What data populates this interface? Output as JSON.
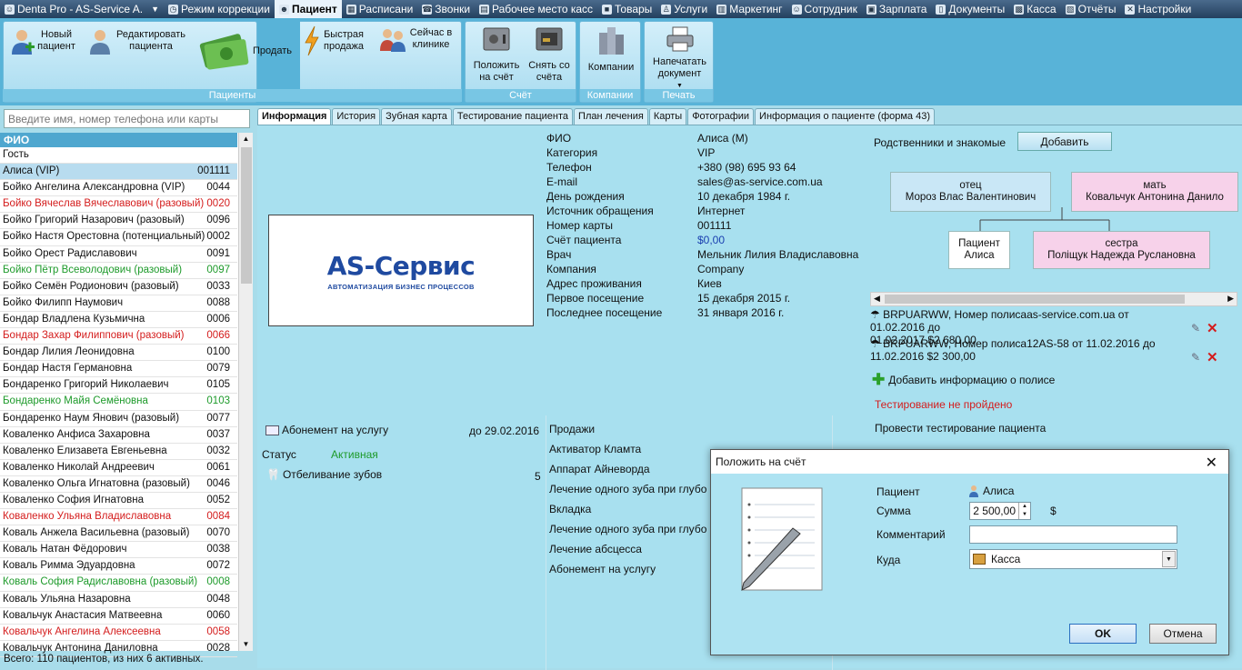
{
  "menubar": {
    "app_title": "Denta Pro - AS-Service A.",
    "items": [
      {
        "label": "Режим коррекции",
        "icon": "clock-icon"
      },
      {
        "label": "Пациент",
        "icon": "person-icon"
      },
      {
        "label": "Расписани",
        "icon": "calendar-icon"
      },
      {
        "label": "Звонки",
        "icon": "phone-icon"
      },
      {
        "label": "Рабочее место касс",
        "icon": "cashier-icon"
      },
      {
        "label": "Товары",
        "icon": "box-icon"
      },
      {
        "label": "Услуги",
        "icon": "tooth-icon"
      },
      {
        "label": "Маркетинг",
        "icon": "chart-icon"
      },
      {
        "label": "Сотрудник",
        "icon": "staff-icon"
      },
      {
        "label": "Зарплата",
        "icon": "money-icon"
      },
      {
        "label": "Документы",
        "icon": "document-icon"
      },
      {
        "label": "Касса",
        "icon": "register-icon"
      },
      {
        "label": "Отчёты",
        "icon": "report-icon"
      },
      {
        "label": "Настройки",
        "icon": "tools-icon"
      }
    ]
  },
  "ribbon": {
    "patients_group": "Пациенты",
    "new_patient": "Новый пациент",
    "edit_patient": "Редактировать пациента",
    "sell": "Продать",
    "quick_sale": "Быстрая продажа",
    "in_clinic": "Сейчас в клинике",
    "account_group": "Счёт",
    "deposit": "Положить на счёт",
    "withdraw": "Снять со счёта",
    "companies_group": "Компании",
    "companies": "Компании",
    "print_group": "Печать",
    "print_doc": "Напечатать документ"
  },
  "search": {
    "placeholder": "Введите имя, номер телефона или карты"
  },
  "patient_list": {
    "header": "ФИО",
    "footer": "Всего: 110 пациентов, из них 6 активных.",
    "rows": [
      {
        "name": "Гость",
        "id": "",
        "style": "normal"
      },
      {
        "name": "Алиса (VIP)",
        "id": "001111",
        "style": "selected"
      },
      {
        "name": "Бойко Ангелина Александровна (VIP)",
        "id": "0044",
        "style": "normal"
      },
      {
        "name": "Бойко Вячеслав Вячеславович (разовый)",
        "id": "0020",
        "style": "red"
      },
      {
        "name": "Бойко Григорий Назарович (разовый)",
        "id": "0096",
        "style": "normal"
      },
      {
        "name": "Бойко Настя Орестовна (потенциальный)",
        "id": "0002",
        "style": "normal"
      },
      {
        "name": "Бойко Орест Радиславович",
        "id": "0091",
        "style": "normal"
      },
      {
        "name": "Бойко Пётр Всеволодович (разовый)",
        "id": "0097",
        "style": "green"
      },
      {
        "name": "Бойко Семён Родионович (разовый)",
        "id": "0033",
        "style": "normal"
      },
      {
        "name": "Бойко Филипп Наумович",
        "id": "0088",
        "style": "normal"
      },
      {
        "name": "Бондар Владлена Кузьмична",
        "id": "0006",
        "style": "normal"
      },
      {
        "name": "Бондар Захар Филиппович (разовый)",
        "id": "0066",
        "style": "red"
      },
      {
        "name": "Бондар Лилия Леонидовна",
        "id": "0100",
        "style": "normal"
      },
      {
        "name": "Бондар Настя Германовна",
        "id": "0079",
        "style": "normal"
      },
      {
        "name": "Бондаренко Григорий Николаевич",
        "id": "0105",
        "style": "normal"
      },
      {
        "name": "Бондаренко Майя Семёновна",
        "id": "0103",
        "style": "green"
      },
      {
        "name": "Бондаренко Наум Янович (разовый)",
        "id": "0077",
        "style": "normal"
      },
      {
        "name": "Коваленко Анфиса Захаровна",
        "id": "0037",
        "style": "normal"
      },
      {
        "name": "Коваленко Елизавета Евгеньевна",
        "id": "0032",
        "style": "normal"
      },
      {
        "name": "Коваленко Николай Андреевич",
        "id": "0061",
        "style": "normal"
      },
      {
        "name": "Коваленко Ольга Игнатовна (разовый)",
        "id": "0046",
        "style": "normal"
      },
      {
        "name": "Коваленко София Игнатовна",
        "id": "0052",
        "style": "normal"
      },
      {
        "name": "Коваленко Ульяна Владиславовна",
        "id": "0084",
        "style": "red"
      },
      {
        "name": "Коваль Анжела Васильевна (разовый)",
        "id": "0070",
        "style": "normal"
      },
      {
        "name": "Коваль Натан Фёдорович",
        "id": "0038",
        "style": "normal"
      },
      {
        "name": "Коваль Римма Эдуардовна",
        "id": "0072",
        "style": "normal"
      },
      {
        "name": "Коваль София Радиславовна (разовый)",
        "id": "0008",
        "style": "green"
      },
      {
        "name": "Коваль Ульяна Назаровна",
        "id": "0048",
        "style": "normal"
      },
      {
        "name": "Ковальчук Анастасия Матвеевна",
        "id": "0060",
        "style": "normal"
      },
      {
        "name": "Ковальчук Ангелина Алексеевна",
        "id": "0058",
        "style": "red"
      },
      {
        "name": "Ковальчук Антонина Даниловна",
        "id": "0028",
        "style": "normal"
      }
    ]
  },
  "tabs": [
    "Информация",
    "История",
    "Зубная карта",
    "Тестирование пациента",
    "План лечения",
    "Карты",
    "Фотографии",
    "Информация о пациенте (форма 43)"
  ],
  "logo": {
    "main": "AS-Сервис",
    "sub": "АВТОМАТИЗАЦИЯ БИЗНЕС ПРОЦЕССОВ"
  },
  "info": [
    {
      "label": "ФИО",
      "value": "Алиса (М)"
    },
    {
      "label": "Категория",
      "value": "VIP"
    },
    {
      "label": "Телефон",
      "value": "+380 (98) 695 93 64"
    },
    {
      "label": "E-mail",
      "value": "sales@as-service.com.ua"
    },
    {
      "label": "День рождения",
      "value": "10 декабря 1984 г."
    },
    {
      "label": "Источник обращения",
      "value": "Интернет"
    },
    {
      "label": "Номер карты",
      "value": "001111"
    },
    {
      "label": "Счёт пациента",
      "value": "$0,00"
    },
    {
      "label": "Врач",
      "value": "Мельник Лилия Владиславовна"
    },
    {
      "label": "Компания",
      "value": "Company"
    },
    {
      "label": "Адрес проживания",
      "value": "Киев"
    },
    {
      "label": "Первое посещение",
      "value": "15 декабря 2015 г."
    },
    {
      "label": "Последнее посещение",
      "value": "31 января 2016 г."
    }
  ],
  "relatives": {
    "label": "Родственники и знакомые",
    "add_button": "Добавить",
    "father_role": "отец",
    "father_name": "Мороз Влас Валентинович",
    "mother_role": "мать",
    "mother_name": "Ковальчук Антонина Данило",
    "patient_role": "Пациент",
    "patient_name": "Алиса",
    "sister_role": "сестра",
    "sister_name": "Поліщук Надежда Руслановна"
  },
  "policies": [
    {
      "line1": "BRPUARWW, Номер полисаas-service.com.ua от 01.02.2016 до",
      "line2": "01.02.2017 $2 680,00"
    },
    {
      "line1": "BRPUARWW, Номер полиса12AS-58 от 11.02.2016 до",
      "line2": "11.02.2016 $2 300,00"
    }
  ],
  "add_policy": "Добавить информацию о полисе",
  "test_status": "Тестирование не пройдено",
  "run_test": "Провести тестирование пациента",
  "subscription": {
    "name": "Абонемент на услугу",
    "until": "до 29.02.2016",
    "status_label": "Статус",
    "status_value": "Активная",
    "service": "Отбеливание зубов",
    "count": "5"
  },
  "sales": {
    "header": "Продажи",
    "items": [
      "Активатор Кламта",
      "Аппарат Айневорда",
      "Лечение одного зуба при глубо",
      "Вкладка",
      "Лечение одного зуба при глубо",
      "Лечение абсцесса",
      "Абонемент на услугу"
    ]
  },
  "dialog": {
    "title": "Положить на счёт",
    "patient_label": "Пациент",
    "patient_value": "Алиса",
    "amount_label": "Сумма",
    "amount_value": "2 500,00",
    "currency": "$",
    "comment_label": "Комментарий",
    "comment_value": "",
    "target_label": "Куда",
    "target_value": "Касса",
    "ok": "OK",
    "cancel": "Отмена"
  },
  "colors": {
    "menubar": "#2d4a6a",
    "ribbon": "#58b3d8",
    "content": "#a8e0ef",
    "red": "#d41c1c",
    "green": "#1d9a2a",
    "link_blue": "#1a3fb0"
  }
}
